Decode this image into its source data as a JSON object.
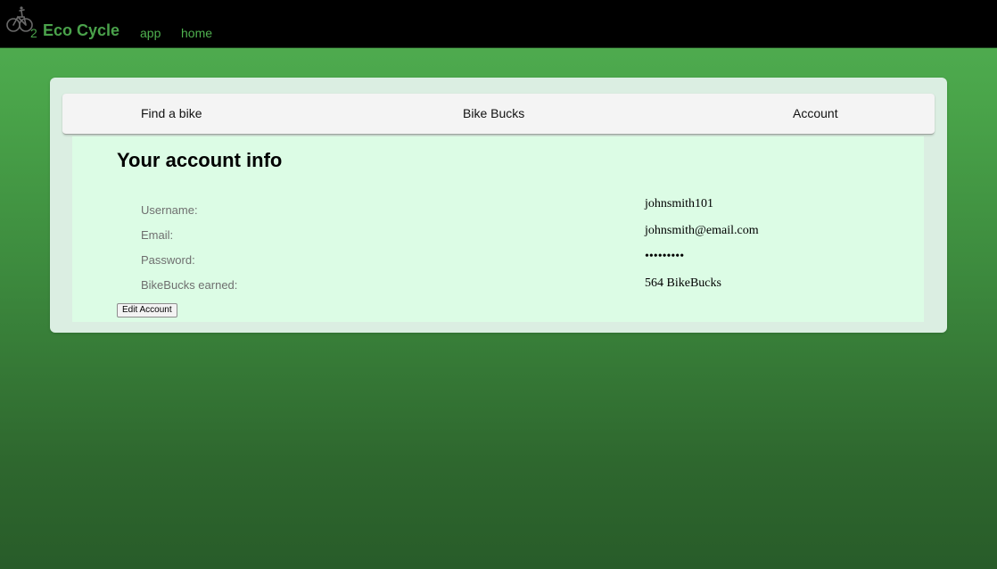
{
  "app": {
    "brand_name": "Eco Cycle",
    "logo_subscript": "2",
    "nav": [
      {
        "label": "app"
      },
      {
        "label": "home"
      }
    ]
  },
  "tabs": [
    {
      "label": "Find a bike"
    },
    {
      "label": "Bike Bucks"
    },
    {
      "label": "Account"
    }
  ],
  "account": {
    "title": "Your account info",
    "fields": [
      {
        "label": "Username:",
        "value": "johnsmith101"
      },
      {
        "label": "Email:",
        "value": "johnsmith@email.com"
      },
      {
        "label": "Password:",
        "value": "•••••••••"
      },
      {
        "label": "BikeBucks earned:",
        "value": "564 BikeBucks"
      }
    ],
    "edit_button_label": "Edit Account"
  },
  "colors": {
    "topbar": "#000000",
    "brand_green": "#4aa24b",
    "background_green_top": "#52b053",
    "background_green_bottom": "#285c29",
    "panel_background": "#dcfce5"
  }
}
